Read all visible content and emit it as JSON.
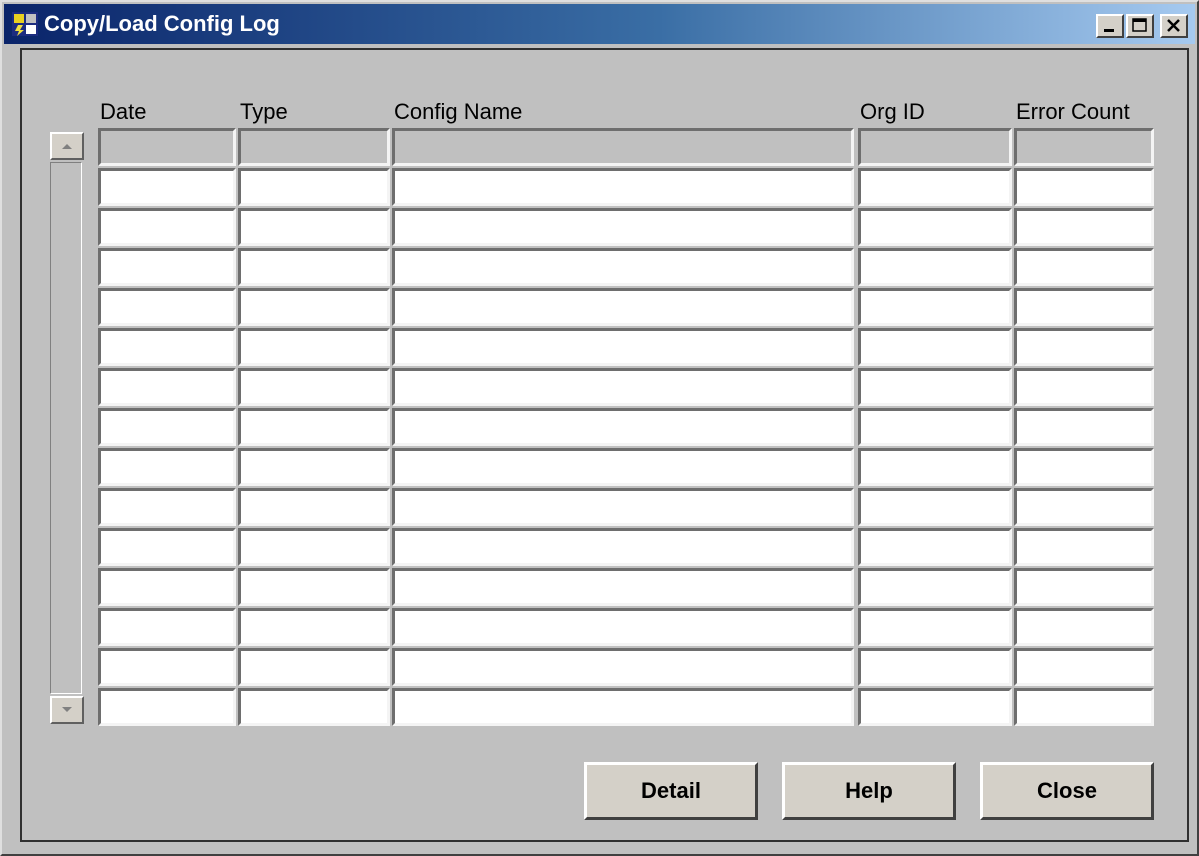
{
  "window": {
    "title": "Copy/Load Config Log"
  },
  "title_bar": {
    "icon": "config-app-icon",
    "buttons": [
      {
        "name": "minimize",
        "icon": "minimize-icon"
      },
      {
        "name": "maximize",
        "icon": "maximize-icon"
      },
      {
        "name": "close",
        "icon": "close-icon"
      }
    ]
  },
  "table": {
    "columns": [
      "Date",
      "Type",
      "Config Name",
      "Org ID",
      "Error Count"
    ],
    "visible_rows": 14,
    "rows": []
  },
  "buttons": {
    "detail": "Detail",
    "help": "Help",
    "close": "Close"
  },
  "colors": {
    "title_gradient_start": "#0a246a",
    "title_gradient_end": "#a6caf0",
    "face": "#c0c0c0",
    "field": "#ffffff"
  }
}
